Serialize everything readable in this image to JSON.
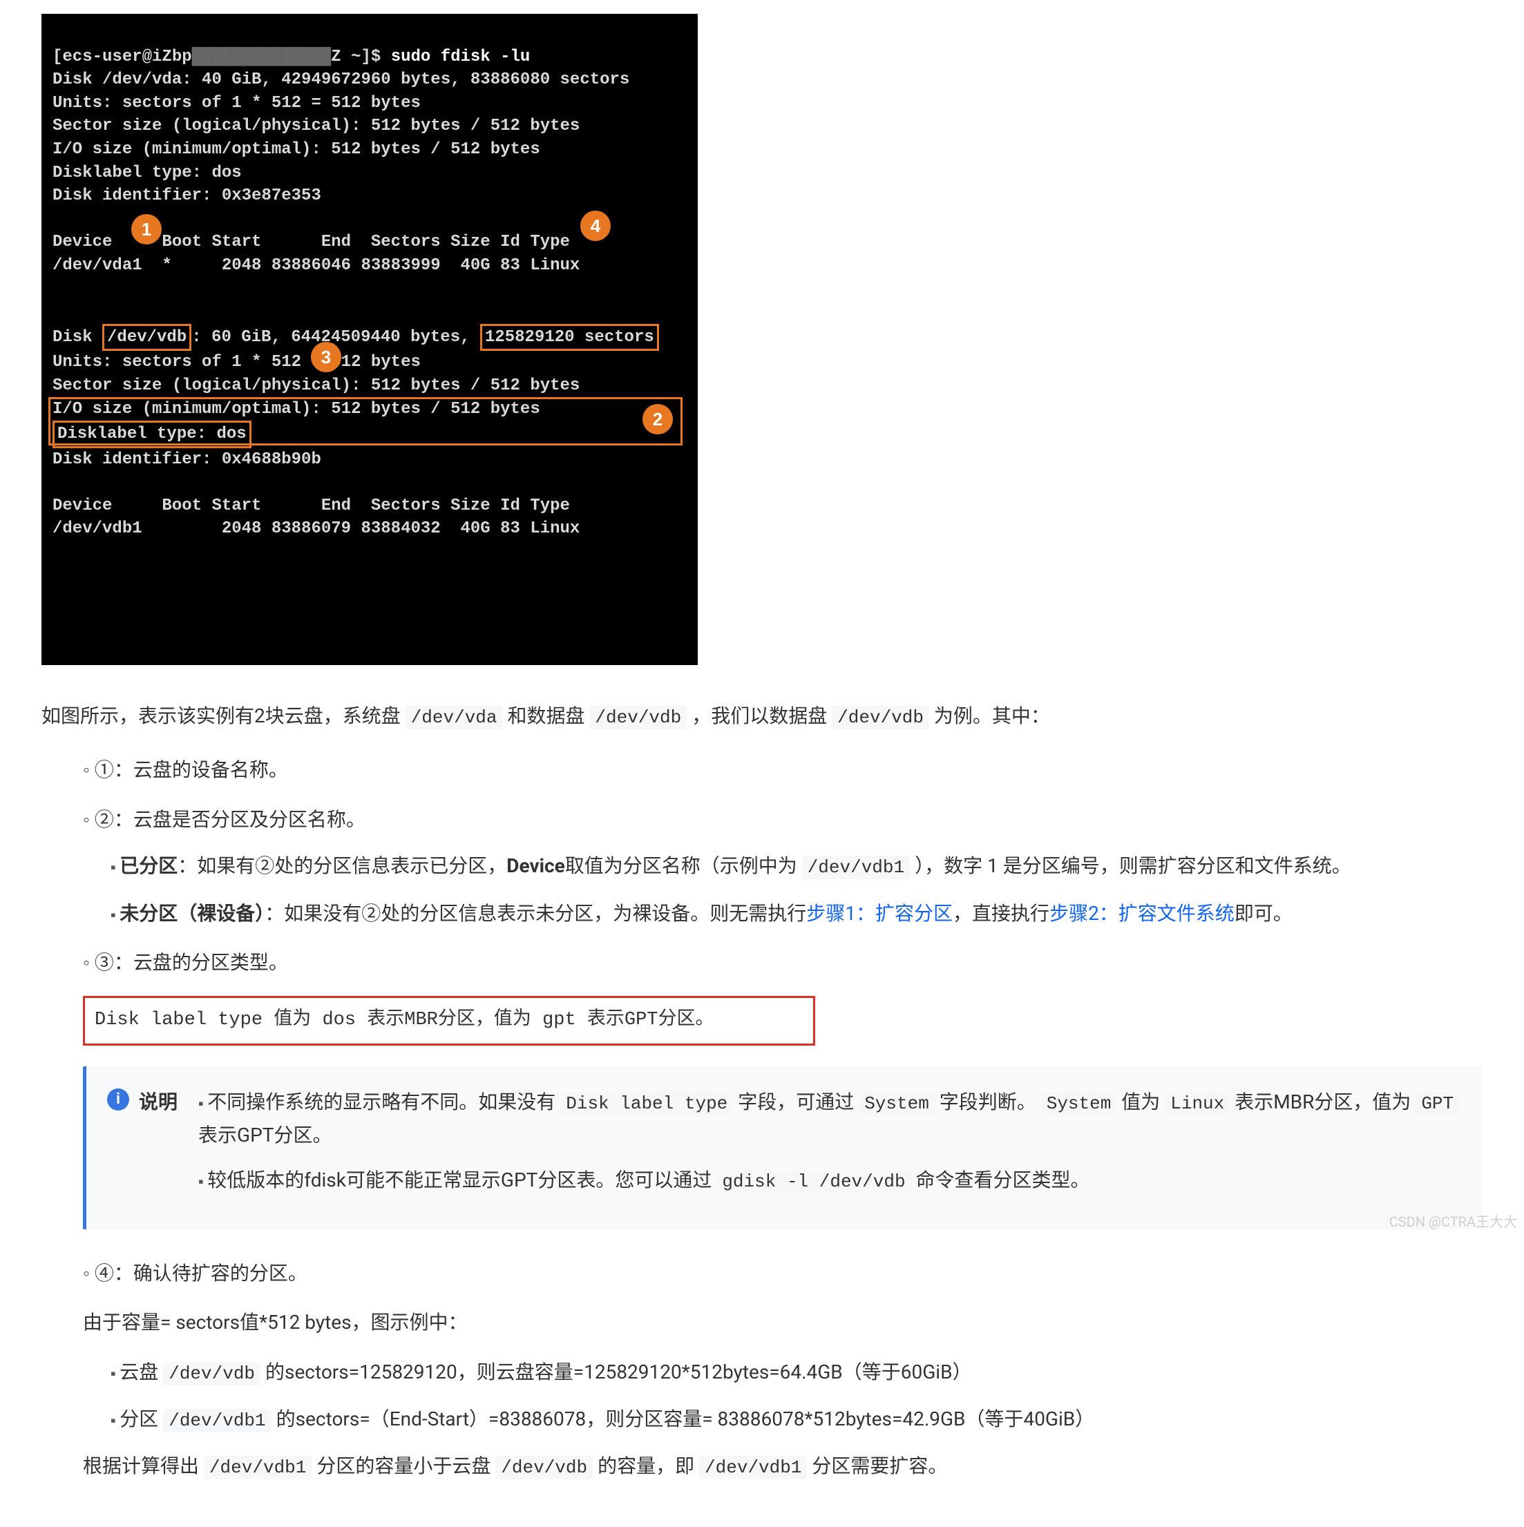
{
  "terminal": {
    "prompt_left": "[ecs-user@iZbp",
    "prompt_blur": "██████████████",
    "prompt_right": "Z ~]$ ",
    "cmd": "sudo fdisk -lu",
    "vda_disk": "Disk /dev/vda: 40 GiB, 42949672960 bytes, 83886080 sectors",
    "units": "Units: sectors of 1 * 512 = 512 bytes",
    "sector": "Sector size (logical/physical): 512 bytes / 512 bytes",
    "io": "I/O size (minimum/optimal): 512 bytes / 512 bytes",
    "labeltype_dos": "Disklabel type: dos",
    "ident_vda": "Disk identifier: 0x3e87e353",
    "hdr": "Device     Boot Start      End  Sectors Size Id Type",
    "vda1": "/dev/vda1  *     2048 83886046 83883999  40G 83 Linux",
    "vdb_disk_pre": "Disk ",
    "vdb_disk_name": "/dev/vdb",
    "vdb_disk_mid": ": 60 GiB, 64424509440 bytes, ",
    "vdb_sectors": "125829120 sectors",
    "io2": "I/O size (minimum/optimal): 512 bytes / 512 bytes",
    "labeltype_box": "Disklabel type: dos",
    "ident_vdb": "Disk identifier: 0x4688b90b",
    "hdr2": "Device     Boot Start      End  Sectors Size Id Type",
    "vdb1": "/dev/vdb1        2048 83886079 83884032  40G 83 Linux",
    "badges": {
      "b1": "1",
      "b2": "2",
      "b3": "3",
      "b4": "4"
    }
  },
  "intro": {
    "pre": "如图所示，表示该实例有2块云盘，系统盘 ",
    "code1": "/dev/vda",
    "mid1": " 和数据盘 ",
    "code2": "/dev/vdb",
    "mid2": " ，我们以数据盘 ",
    "code3": "/dev/vdb",
    "end": " 为例。其中："
  },
  "list": {
    "i1": "①：云盘的设备名称。",
    "i2": "②：云盘是否分区及分区名称。",
    "i2a_strong": "已分区",
    "i2a_t1": "：如果有②处的分区信息表示已分区，",
    "i2a_dev": "Device",
    "i2a_t2": "取值为分区名称（示例中为 ",
    "i2a_code": "/dev/vdb1",
    "i2a_t3": " ），数字 1 是分区编号，则需扩容分区和文件系统。",
    "i2b_strong": "未分区（裸设备）",
    "i2b_t1": "：如果没有②处的分区信息表示未分区，为裸设备。则无需执行",
    "i2b_link1": "步骤1：扩容分区",
    "i2b_t2": "，直接执行",
    "i2b_link2": "步骤2：扩容文件系统",
    "i2b_t3": "即可。",
    "i3": "③：云盘的分区类型。",
    "red_t1": "Disk label type 值为 ",
    "red_c1": "dos",
    "red_t2": " 表示MBR分区，值为 ",
    "red_c2": "gpt",
    "red_t3": " 表示GPT分区。",
    "i4": "④：确认待扩容的分区。",
    "i4_sub": "由于容量= sectors值*512 bytes，图示例中：",
    "i4a_t1": "云盘 ",
    "i4a_c1": "/dev/vdb",
    "i4a_t2": " 的sectors=125829120，则云盘容量=125829120*512bytes=64.4GB（等于60GiB）",
    "i4b_t1": "分区 ",
    "i4b_c1": "/dev/vdb1",
    "i4b_t2": " 的sectors=（End-Start）=83886078，则分区容量= 83886078*512bytes=42.9GB（等于40GiB）",
    "i4_conc_t1": "根据计算得出 ",
    "i4_conc_c1": "/dev/vdb1",
    "i4_conc_t2": " 分区的容量小于云盘 ",
    "i4_conc_c2": "/dev/vdb",
    "i4_conc_t3": " 的容量，即 ",
    "i4_conc_c3": "/dev/vdb1",
    "i4_conc_t4": " 分区需要扩容。"
  },
  "note": {
    "title": "说明",
    "n1_t1": "不同操作系统的显示略有不同。如果没有 ",
    "n1_c1": "Disk label type",
    "n1_t2": " 字段，可通过 ",
    "n1_c2": "System",
    "n1_t3": " 字段判断。 ",
    "n1_c3": "System",
    "n1_t4": " 值为 ",
    "n1_c4": "Linux",
    "n1_t5": " 表示MBR分区，值为 ",
    "n1_c5": "GPT",
    "n1_t6": " 表示GPT分区。",
    "n2_t1": "较低版本的fdisk可能不能正常显示GPT分区表。您可以通过 ",
    "n2_c1": "gdisk -l /dev/vdb",
    "n2_t2": " 命令查看分区类型。"
  },
  "watermark": "CSDN @CTRA王大大"
}
